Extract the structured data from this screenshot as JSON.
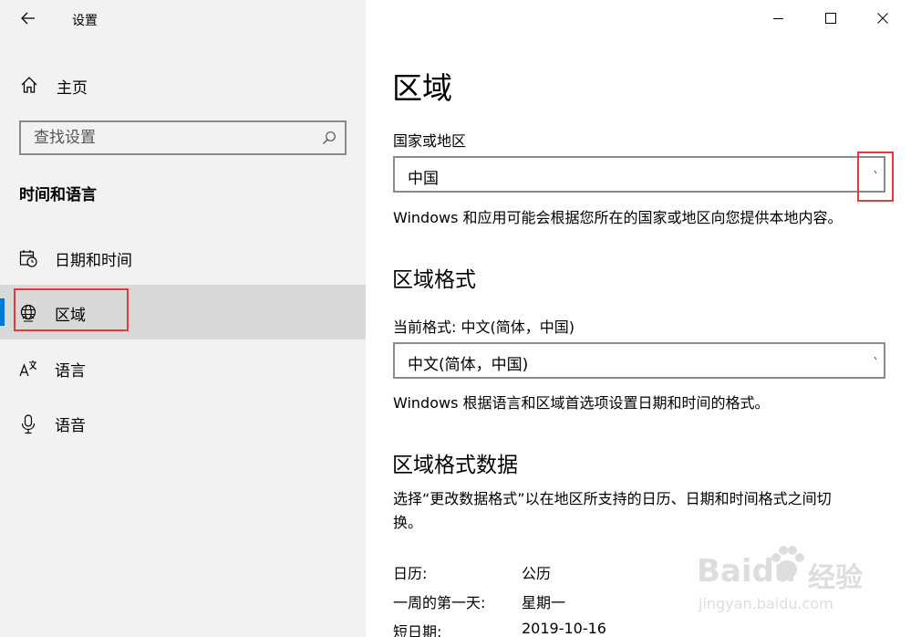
{
  "window": {
    "title": "设置"
  },
  "sidebar": {
    "home_label": "主页",
    "search_placeholder": "查找设置",
    "section_heading": "时间和语言",
    "items": [
      {
        "label": "日期和时间",
        "icon": "calendar-clock-icon"
      },
      {
        "label": "区域",
        "icon": "globe-icon",
        "selected": true
      },
      {
        "label": "语言",
        "icon": "language-icon"
      },
      {
        "label": "语音",
        "icon": "microphone-icon"
      }
    ]
  },
  "main": {
    "title": "区域",
    "country": {
      "label": "国家或地区",
      "value": "中国",
      "description": "Windows 和应用可能会根据您所在的国家或地区向您提供本地内容。"
    },
    "format": {
      "heading": "区域格式",
      "label": "当前格式: 中文(简体，中国)",
      "value": "中文(简体，中国)",
      "description": "Windows 根据语言和区域首选项设置日期和时间的格式。"
    },
    "format_data": {
      "heading": "区域格式数据",
      "description_line1": "选择“更改数据格式”以在地区所支持的日历、日期和时间格式之间切",
      "description_line2": "换。",
      "rows": [
        {
          "key": "日历:",
          "value": "公历"
        },
        {
          "key": "一周的第一天:",
          "value": "星期一"
        },
        {
          "key": "短日期:",
          "value": "2019-10-16"
        }
      ]
    }
  },
  "watermark": {
    "brand": "Baidu",
    "brand_cn": "经验",
    "url": "jingyan.baidu.com"
  },
  "colors": {
    "accent": "#0078d7",
    "highlight_box": "#e53935",
    "sidebar_bg": "#f2f2f2",
    "selected_bg": "#d9d9d9"
  }
}
